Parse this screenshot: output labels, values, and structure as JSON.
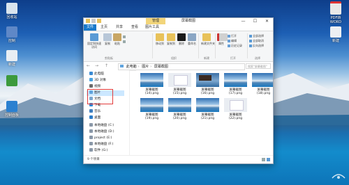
{
  "desktop": {
    "icons_left": [
      {
        "label": "回收站",
        "icon": "recycle-bin-icon",
        "color": "#d9e4ee"
      },
      {
        "label": "控制",
        "icon": "control-panel-icon",
        "color": "#5f88c7"
      },
      {
        "label": "新建",
        "icon": "new-item-icon",
        "color": "#e9eef3"
      },
      {
        "label": "",
        "icon": "app-shortcut-icon",
        "color": "#3c9a3c"
      },
      {
        "label": "控制面板",
        "icon": "control-panel-icon",
        "color": "#2b80d0"
      }
    ],
    "icons_right": [
      {
        "label": "PDF转WORD",
        "icon": "pdf-converter-icon",
        "color": "#e8e8e8"
      },
      {
        "label": "新建",
        "icon": "new-file-icon",
        "color": "#eceff3"
      }
    ]
  },
  "window": {
    "title": "屏幕截图",
    "context_tab": "管理",
    "buttons": {
      "minimize": "—",
      "maximize": "☐",
      "close": "✕"
    },
    "tabs": [
      "文件",
      "主页",
      "共享",
      "查看",
      "图片工具"
    ],
    "ribbon": {
      "pin_label": "固定到快速访问",
      "copy_label": "复制",
      "paste_label": "粘贴",
      "move_label": "移动到",
      "copy_to_label": "复制到",
      "delete_label": "删除",
      "rename_label": "重命名",
      "new_folder_label": "新建文件夹",
      "properties_label": "属性",
      "open_label": "打开",
      "edit_label": "编辑",
      "history_label": "历史记录",
      "select_all_label": "全部选择",
      "select_none_label": "全部取消",
      "invert_label": "反向选择",
      "group_clipboard": "剪贴板",
      "group_organize": "组织",
      "group_new": "新建",
      "group_open": "打开",
      "group_select": "选择"
    },
    "address": {
      "back": "←",
      "forward": "→",
      "up": "↑",
      "crumbs": [
        "此电脑",
        "图片",
        "屏幕截图"
      ],
      "search_placeholder": "搜索\"屏幕截图\""
    },
    "nav_items": [
      {
        "label": "此电脑",
        "icon": "computer-icon",
        "color": "#3a8ad3"
      },
      {
        "label": "3D 对象",
        "icon": "3d-objects-icon",
        "color": "#4aa3e0"
      },
      {
        "label": "视频",
        "icon": "videos-icon",
        "color": "#6a6a6a"
      },
      {
        "label": "图片",
        "icon": "pictures-icon",
        "color": "#5fa4de",
        "selected": true
      },
      {
        "label": "文档",
        "icon": "documents-icon",
        "color": "#7aa6cf"
      },
      {
        "label": "下载",
        "icon": "downloads-icon",
        "color": "#2f86d4"
      },
      {
        "label": "音乐",
        "icon": "music-icon",
        "color": "#3f7fbf"
      },
      {
        "label": "桌面",
        "icon": "desktop-icon",
        "color": "#2d7dc9"
      },
      {
        "label": "本地磁盘 (C:)",
        "icon": "drive-icon",
        "color": "#8a98a8"
      },
      {
        "label": "本地磁盘 (D:)",
        "icon": "drive-icon",
        "color": "#8a98a8"
      },
      {
        "label": "project (E:)",
        "icon": "drive-icon",
        "color": "#8a98a8"
      },
      {
        "label": "本地磁盘 (F:)",
        "icon": "drive-icon",
        "color": "#8a98a8"
      },
      {
        "label": "软件 (G:)",
        "icon": "drive-icon",
        "color": "#8a98a8"
      },
      {
        "label": "网络",
        "icon": "network-icon",
        "color": "#3b7fc4"
      }
    ],
    "files": [
      {
        "label": "屏幕截图 (14).png",
        "thumb": "blue"
      },
      {
        "label": "屏幕截图 (15).png",
        "thumb": "white"
      },
      {
        "label": "屏幕截图 (16).png",
        "thumb": "dark"
      },
      {
        "label": "屏幕截图 (17).png",
        "thumb": "blue"
      },
      {
        "label": "屏幕截图 (18).png",
        "thumb": "blue"
      },
      {
        "label": "屏幕截图 (19).png",
        "thumb": "blue"
      },
      {
        "label": "屏幕截图 (20).png",
        "thumb": "blue"
      },
      {
        "label": "屏幕截图 (21).png",
        "thumb": "blue"
      },
      {
        "label": "屏幕截图 (22).png",
        "thumb": "white"
      }
    ],
    "status": "9 个项目"
  },
  "colors": {
    "accent": "#1979ca",
    "selection": "#cce8ff",
    "highlight_box": "#e23b3b",
    "context_tab": "#f2d57a"
  }
}
